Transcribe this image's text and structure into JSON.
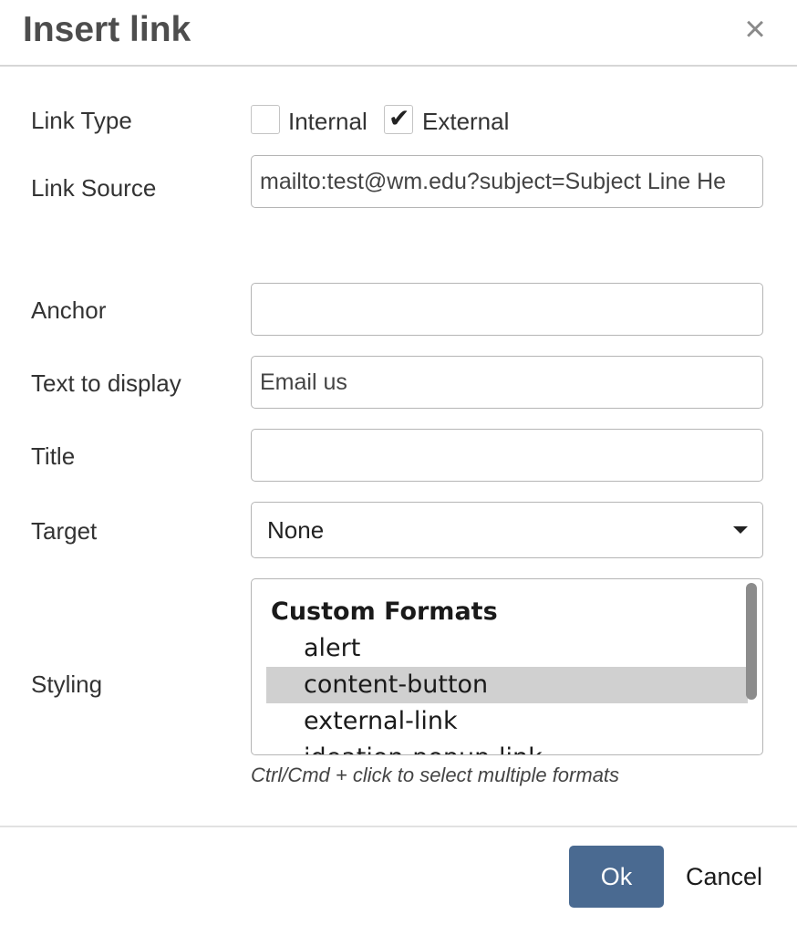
{
  "dialog": {
    "title": "Insert link",
    "close_glyph": "×"
  },
  "link_type": {
    "label": "Link Type",
    "options": [
      {
        "label": "Internal",
        "checked": false
      },
      {
        "label": "External",
        "checked": true
      }
    ],
    "check_glyph": "✔"
  },
  "link_source": {
    "label": "Link Source",
    "value": "mailto:test@wm.edu?subject=Subject Line He"
  },
  "anchor": {
    "label": "Anchor",
    "value": ""
  },
  "text_to_display": {
    "label": "Text to display",
    "value": "Email us"
  },
  "title_field": {
    "label": "Title",
    "value": ""
  },
  "target": {
    "label": "Target",
    "selected": "None"
  },
  "styling": {
    "label": "Styling",
    "group_label": "Custom Formats",
    "items": [
      {
        "label": "alert",
        "selected": false
      },
      {
        "label": "content-button",
        "selected": true
      },
      {
        "label": "external-link",
        "selected": false
      },
      {
        "label": "ideation-popup-link",
        "selected": false
      }
    ],
    "hint": "Ctrl/Cmd + click to select multiple formats"
  },
  "footer": {
    "ok_label": "Ok",
    "cancel_label": "Cancel"
  },
  "colors": {
    "primary_button": "#4a6a91",
    "selected_item_bg": "#d0d0d0"
  },
  "icons": {
    "close": "close-icon",
    "checkmark": "checkmark-icon",
    "dropdown": "chevron-down-icon"
  }
}
